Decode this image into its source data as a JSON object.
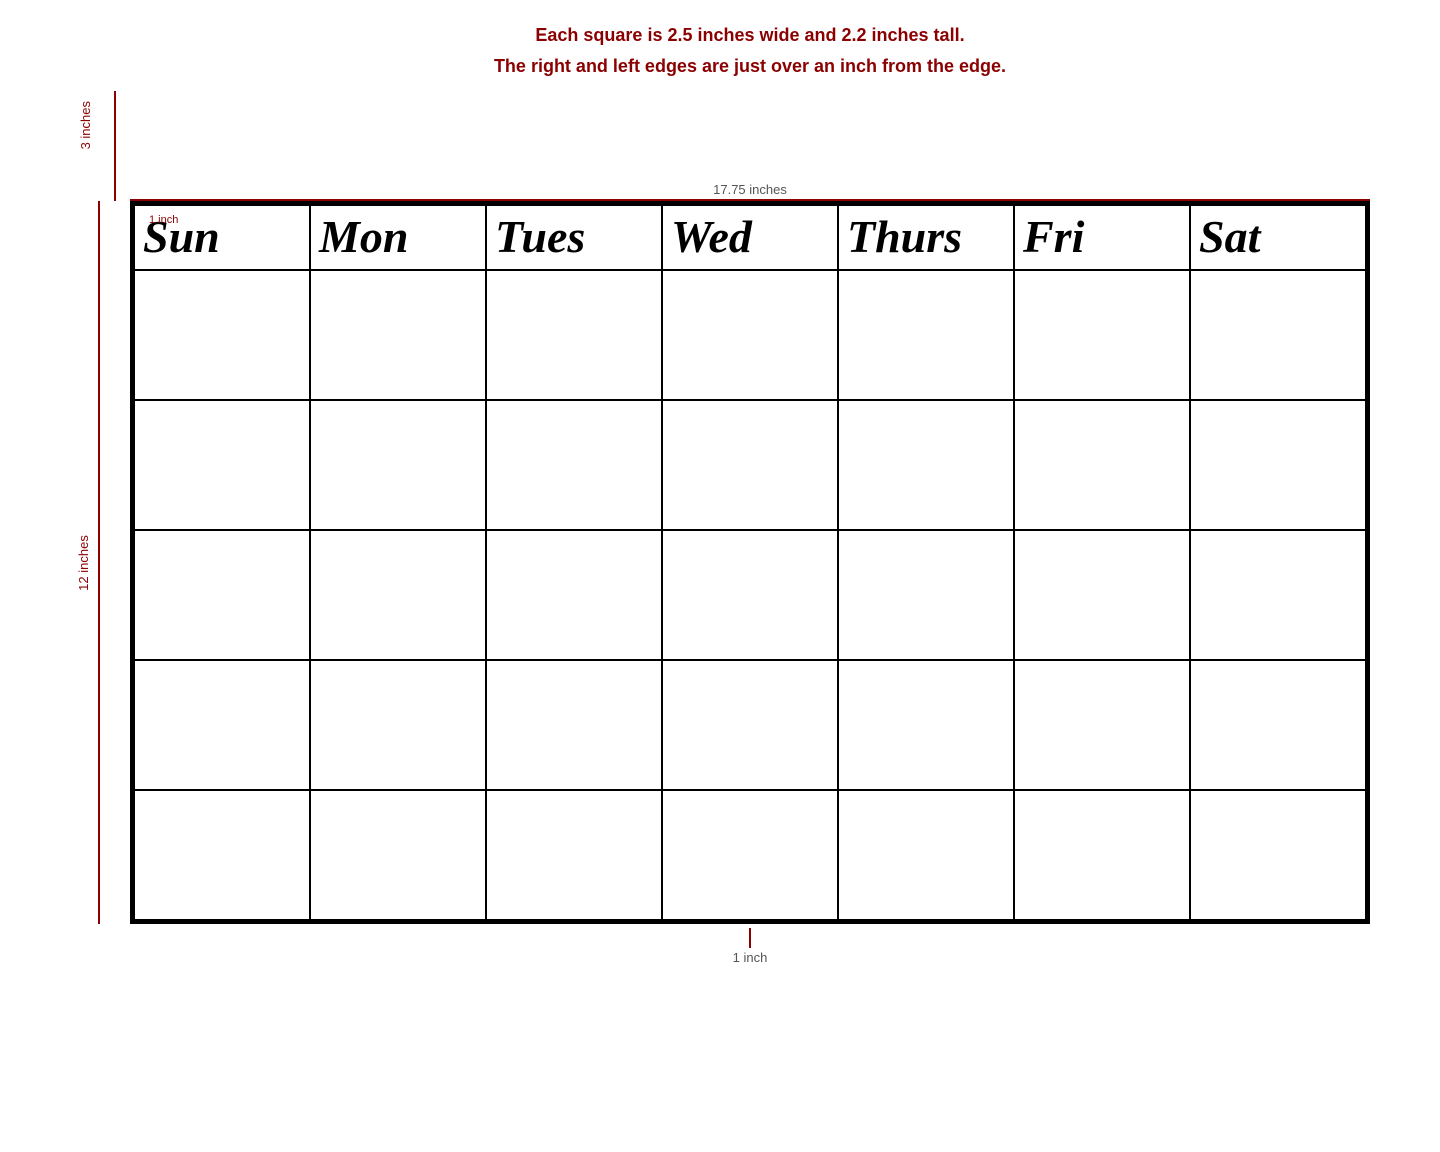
{
  "instructions": {
    "line1": "Each square is 2.5 inches wide and 2.2 inches tall.",
    "line2": "The right and left edges are just over an inch from the edge."
  },
  "measurements": {
    "top_vertical": "3 inches",
    "horizontal": "17.75 inches",
    "left_vertical": "12 inches",
    "bottom_tick": "1 inch",
    "sun_corner": "1 inch"
  },
  "days": [
    "Sun",
    "Mon",
    "Tues",
    "Wed",
    "Thurs",
    "Fri",
    "Sat"
  ],
  "rows": 5,
  "colors": {
    "accent": "#8B0000",
    "border": "#000000",
    "text": "#000000"
  }
}
